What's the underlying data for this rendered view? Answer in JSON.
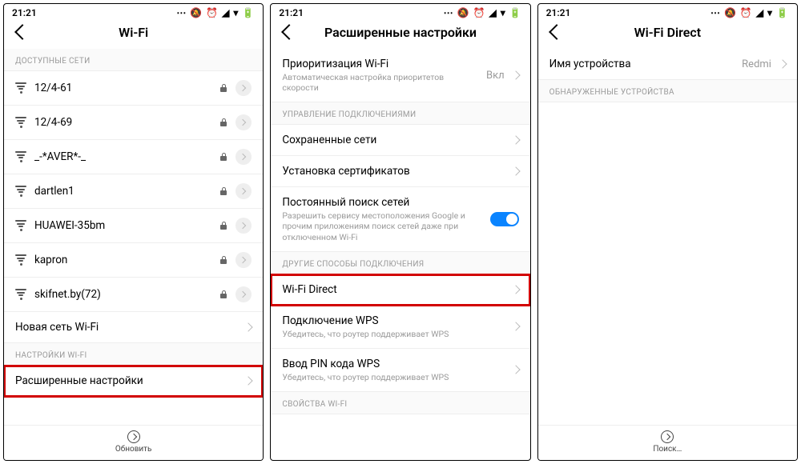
{
  "status_time": "21:21",
  "status_icons": "⋯ 🔕 ⏰ ◢ ▾ 🔋",
  "screen1": {
    "title": "Wi-Fi",
    "section_available": "ДОСТУПНЫЕ СЕТИ",
    "networks": [
      "12/4-61",
      "12/4-69",
      "_-*AVER*-_",
      "dartlen1",
      "HUAWEI-35bm",
      "kapron",
      "skifnet.by(72)"
    ],
    "new_network": "Новая сеть Wi-Fi",
    "section_settings": "НАСТРОЙКИ WI-FI",
    "advanced": "Расширенные настройки",
    "footer": "Обновить"
  },
  "screen2": {
    "title": "Расширенные настройки",
    "priority_title": "Приоритизация Wi-Fi",
    "priority_sub": "Автоматическая настройка приоритетов скорости",
    "priority_value": "Вкл",
    "section_conn": "УПРАВЛЕНИЕ ПОДКЛЮЧЕНИЯМИ",
    "saved_networks": "Сохраненные сети",
    "install_certs": "Установка сертификатов",
    "always_scan_title": "Постоянный поиск сетей",
    "always_scan_sub": "Разрешить сервису местоположения Google и прочим приложениям поиск сетей даже при отключенном Wi-Fi",
    "section_other": "ДРУГИЕ СПОСОБЫ ПОДКЛЮЧЕНИЯ",
    "wifi_direct": "Wi-Fi Direct",
    "wps_connect_title": "Подключение WPS",
    "wps_connect_sub": "Убедитесь, что роутер поддерживает WPS",
    "wps_pin_title": "Ввод PIN кода WPS",
    "wps_pin_sub": "Убедитесь, что роутер поддерживает WPS",
    "section_props": "СВОЙСТВА WI-FI"
  },
  "screen3": {
    "title": "Wi-Fi Direct",
    "device_name_label": "Имя устройства",
    "device_name_value": "Redmi",
    "section_found": "ОБНАРУЖЕННЫЕ УСТРОЙСТВА",
    "footer": "Поиск…"
  }
}
